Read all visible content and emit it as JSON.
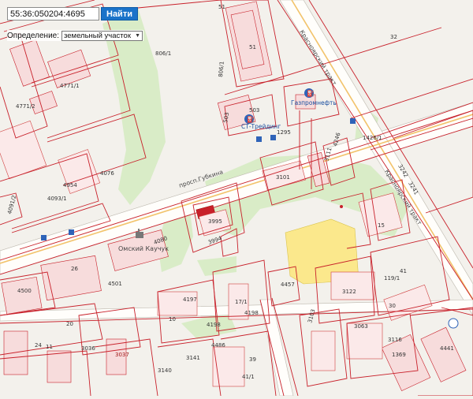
{
  "search": {
    "value": "55:36:050204:4695",
    "button_label": "Найти"
  },
  "definition": {
    "label": "Определение:",
    "selected": "земельный участок"
  },
  "map": {
    "streets": [
      "просп.Губкина",
      "Красноярский тракт",
      "Красноярский тракт"
    ],
    "poi": [
      {
        "name": "СТ-Трейдинг",
        "icon": "fuel-station-icon"
      },
      {
        "name": "Газпромнефть",
        "icon": "fuel-station-icon"
      },
      {
        "name": "Омский Каучук",
        "icon": "factory-icon"
      }
    ],
    "parcel_labels": [
      "51",
      "51",
      "32",
      "806/1",
      "806/1",
      "503",
      "503",
      "1295",
      "4771/1",
      "4771/2",
      "4076",
      "4954",
      "4093/1",
      "4091/2",
      "1426/1",
      "4246",
      "3101",
      "3122",
      "3111",
      "3103",
      "3242",
      "3241",
      "3995",
      "3994",
      "4080",
      "4501",
      "4500",
      "4457",
      "4197",
      "4198",
      "4198",
      "17/1",
      "15",
      "41",
      "119/1",
      "30",
      "3063",
      "3116",
      "4441",
      "1369",
      "4486",
      "3141",
      "3140",
      "3036",
      "3037",
      "11",
      "20",
      "10",
      "39",
      "41/1",
      "26",
      "24"
    ]
  }
}
